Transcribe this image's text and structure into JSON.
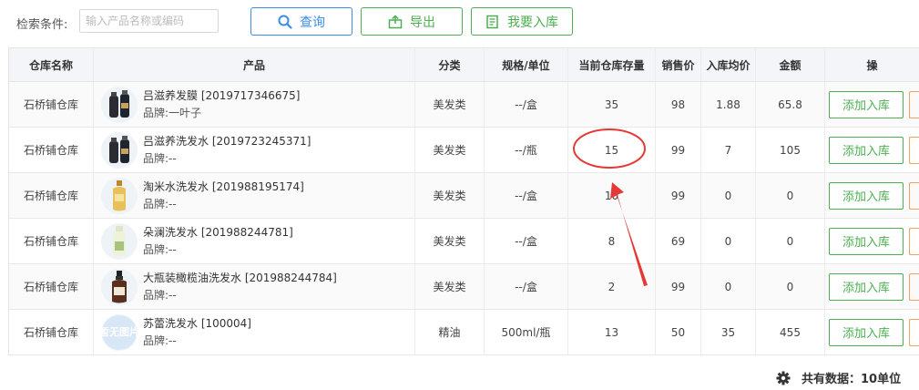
{
  "search": {
    "label": "检索条件:",
    "placeholder": "输入产品名称或编码",
    "value": ""
  },
  "buttons": {
    "query": "查询",
    "export": "导出",
    "stock_in": "我要入库"
  },
  "table": {
    "headers": [
      "仓库名称",
      "产品",
      "分类",
      "规格/单位",
      "当前仓库存量",
      "销售价",
      "入库均价",
      "金额",
      "操"
    ],
    "rows": [
      {
        "warehouse": "石桥铺仓库",
        "product": "吕滋养发膜 [2019717346675]",
        "brand": "品牌:一叶子",
        "category": "美发类",
        "spec": "--/盒",
        "stock": "35",
        "price": "98",
        "avg_cost": "1.88",
        "amount": "65.8",
        "action": "添加入库",
        "thumb": "dark-bottles-icon"
      },
      {
        "warehouse": "石桥铺仓库",
        "product": "吕滋养洗发水 [2019723245371]",
        "brand": "品牌:--",
        "category": "美发类",
        "spec": "--/瓶",
        "stock": "15",
        "price": "99",
        "avg_cost": "7",
        "amount": "105",
        "action": "添加入库",
        "thumb": "dark-bottles-icon"
      },
      {
        "warehouse": "石桥铺仓库",
        "product": "淘米水洗发水 [201988195174]",
        "brand": "品牌:--",
        "category": "美发类",
        "spec": "--/盒",
        "stock": "10",
        "price": "99",
        "avg_cost": "0",
        "amount": "0",
        "action": "添加入库",
        "thumb": "gold-bottle-icon"
      },
      {
        "warehouse": "石桥铺仓库",
        "product": "朵澜洗发水 [201988244781]",
        "brand": "品牌:--",
        "category": "美发类",
        "spec": "--/盒",
        "stock": "8",
        "price": "69",
        "avg_cost": "0",
        "amount": "0",
        "action": "添加入库",
        "thumb": "green-bottle-icon"
      },
      {
        "warehouse": "石桥铺仓库",
        "product": "大瓶装橄榄油洗发水 [201988244784]",
        "brand": "品牌:--",
        "category": "美发类",
        "spec": "--/盒",
        "stock": "2",
        "price": "99",
        "avg_cost": "0",
        "amount": "0",
        "action": "添加入库",
        "thumb": "brown-bottle-icon"
      },
      {
        "warehouse": "石桥铺仓库",
        "product": "苏蕾洗发水 [100004]",
        "brand": "品牌:--",
        "category": "精油",
        "spec": "500ml/瓶",
        "stock": "13",
        "price": "50",
        "avg_cost": "35",
        "amount": "455",
        "action": "添加入库",
        "thumb": "no-image-placeholder",
        "no_image_text": "暂无图片"
      }
    ]
  },
  "footer": {
    "summary": "共有数据：10单位"
  },
  "colors": {
    "primary_blue": "#3a8ee6",
    "success_green": "#4caf50",
    "annotation_red": "#e53935"
  }
}
